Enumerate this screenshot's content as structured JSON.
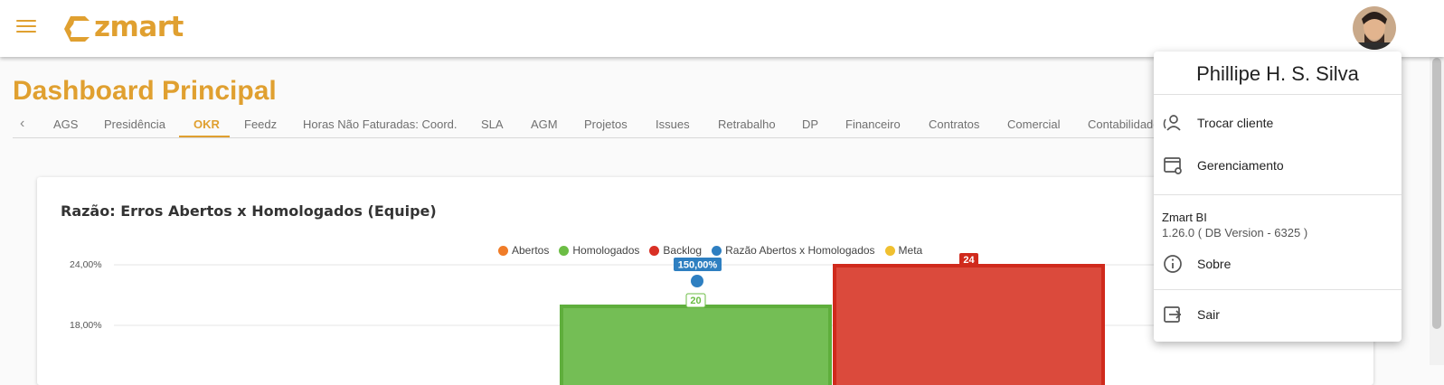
{
  "app": {
    "logo_text": "zmart",
    "brand_color": "#e0a030"
  },
  "page": {
    "title": "Dashboard Principal"
  },
  "tabs": [
    {
      "label": "AGS"
    },
    {
      "label": "Presidência"
    },
    {
      "label": "OKR",
      "active": true
    },
    {
      "label": "Feedz"
    },
    {
      "label": "Horas Não Faturadas: Coord."
    },
    {
      "label": "SLA"
    },
    {
      "label": "AGM"
    },
    {
      "label": "Projetos"
    },
    {
      "label": "Issues"
    },
    {
      "label": "Retrabalho"
    },
    {
      "label": "DP"
    },
    {
      "label": "Financeiro"
    },
    {
      "label": "Contratos"
    },
    {
      "label": "Comercial"
    },
    {
      "label": "Contabilidade"
    }
  ],
  "card": {
    "title": "Razão: Erros Abertos x Homologados (Equipe)"
  },
  "chart_data": {
    "type": "bar",
    "title": "Razão: Erros Abertos x Homologados (Equipe)",
    "legend": [
      {
        "name": "Abertos",
        "color": "#f07c28"
      },
      {
        "name": "Homologados",
        "color": "#6cbd45"
      },
      {
        "name": "Backlog",
        "color": "#d93025"
      },
      {
        "name": "Razão Abertos x Homologados",
        "color": "#2e7fc1"
      },
      {
        "name": "Meta",
        "color": "#f0c030"
      }
    ],
    "y_ticks": [
      "24,00%",
      "18,00%"
    ],
    "bars": [
      {
        "series": "Homologados",
        "value": 20,
        "label": "20",
        "color": "#6cbd45"
      },
      {
        "series": "Backlog",
        "value": 24,
        "label": "24",
        "color": "#d93025"
      }
    ],
    "points": [
      {
        "series": "Razão Abertos x Homologados",
        "value": 150,
        "label": "150,00%",
        "color": "#2e7fc1"
      }
    ]
  },
  "user_menu": {
    "user_name": "Phillipe H. S. Silva",
    "items": [
      {
        "label": "Trocar cliente",
        "icon": "switch-account-icon"
      },
      {
        "label": "Gerenciamento",
        "icon": "settings-window-icon"
      }
    ],
    "app_name": "Zmart BI",
    "version": "1.26.0 ( DB Version - 6325 )",
    "about_label": "Sobre",
    "logout_label": "Sair"
  }
}
